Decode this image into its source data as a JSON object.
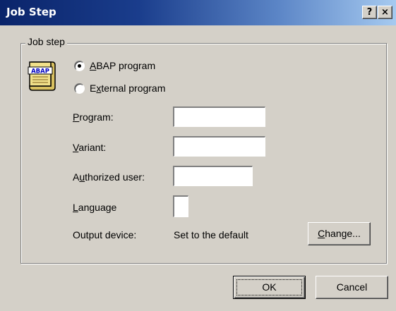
{
  "window": {
    "title": "Job Step",
    "help_label": "?",
    "close_label": "×"
  },
  "group": {
    "label": "Job step"
  },
  "icon": {
    "name": "abap-icon",
    "text": "ABAP"
  },
  "radios": {
    "abap_prefix": "",
    "abap_key": "A",
    "abap_rest": "BAP program",
    "abap_checked": true,
    "ext_prefix": "E",
    "ext_key": "x",
    "ext_rest": "ternal program",
    "ext_checked": false
  },
  "fields": {
    "program_key": "P",
    "program_rest": "rogram:",
    "program_value": "",
    "variant_key": "V",
    "variant_rest": "ariant:",
    "variant_value": "",
    "authuser_prefix": "A",
    "authuser_key": "u",
    "authuser_rest": "thorized user:",
    "authuser_value": "",
    "language_key": "L",
    "language_rest": "anguage",
    "language_value": ""
  },
  "output": {
    "label": "Output device:",
    "value": "Set to the default",
    "change_key": "C",
    "change_rest": "hange..."
  },
  "buttons": {
    "ok": "OK",
    "cancel": "Cancel"
  }
}
